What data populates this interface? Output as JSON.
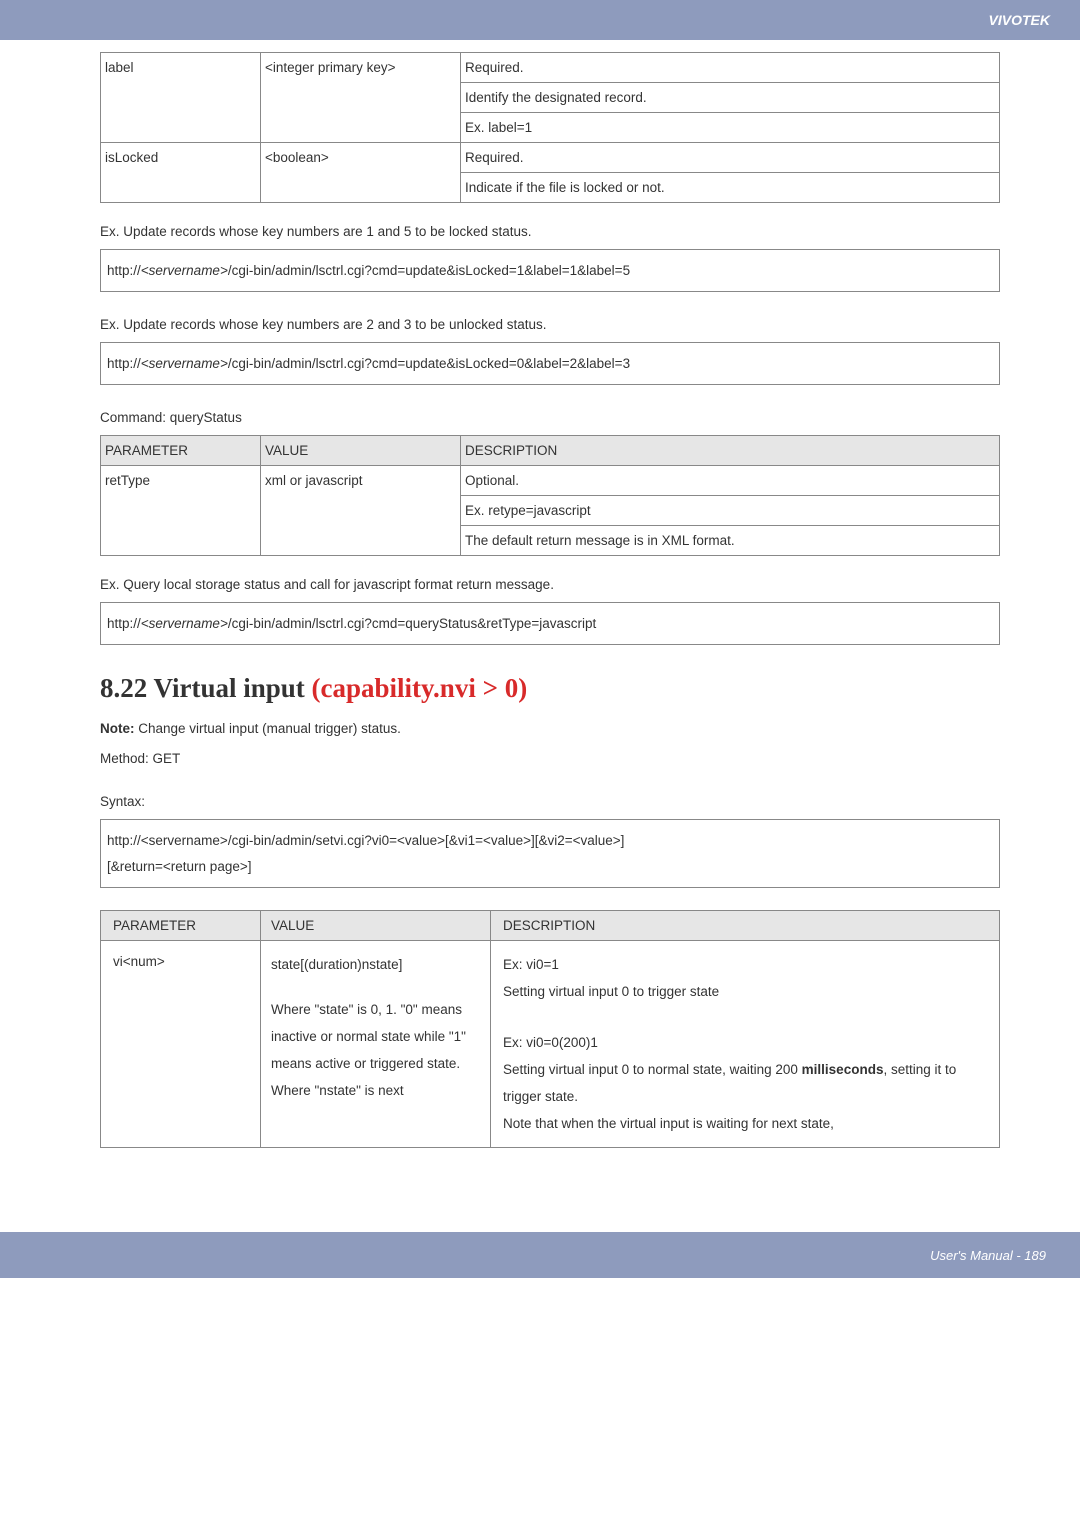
{
  "topbar": {
    "brand": "VIVOTEK"
  },
  "table1": {
    "rows": [
      {
        "param": "label",
        "value": "<integer primary key>",
        "desc_lines": [
          "Required.",
          "Identify the designated record.",
          "Ex. label=1"
        ]
      },
      {
        "param": "isLocked",
        "value": "<boolean>",
        "desc_lines": [
          "Required.",
          "Indicate if the file is locked or not."
        ]
      }
    ]
  },
  "ex1": {
    "caption": "Ex. Update records whose key numbers are 1 and 5 to be locked status.",
    "url_pre": "http://",
    "url_server": "<servername>",
    "url_post": "/cgi-bin/admin/lsctrl.cgi?cmd=update&isLocked=1&label=1&label=5"
  },
  "ex2": {
    "caption": "Ex. Update records whose key numbers are 2 and 3 to be unlocked status.",
    "url_pre": "http://",
    "url_server": "<servername>",
    "url_post": "/cgi-bin/admin/lsctrl.cgi?cmd=update&isLocked=0&label=2&label=3"
  },
  "qs": {
    "heading": "Command: queryStatus"
  },
  "table2": {
    "headers": {
      "p": "PARAMETER",
      "v": "VALUE",
      "d": "DESCRIPTION"
    },
    "rows": [
      {
        "param": "retType",
        "value": "xml or javascript",
        "desc_lines": [
          "Optional.",
          "Ex. retype=javascript",
          "The default return message is in XML format."
        ]
      }
    ]
  },
  "ex3": {
    "caption": "Ex. Query local storage status and call for javascript format return message.",
    "url_pre": "http://",
    "url_server": "<servername>",
    "url_post": "/cgi-bin/admin/lsctrl.cgi?cmd=queryStatus&retType=javascript"
  },
  "section": {
    "num_title": "8.22 Virtual input ",
    "red": "(capability.nvi > 0)",
    "note_label": "Note:",
    "note_text": " Change virtual input (manual trigger) status.",
    "method": "Method: GET",
    "syntax_label": "Syntax:",
    "syntax_line1": "http://<servername>/cgi-bin/admin/setvi.cgi?vi0=<value>[&vi1=<value>][&vi2=<value>]",
    "syntax_line2": "[&return=<return page>]"
  },
  "table3": {
    "headers": {
      "p": "PARAMETER",
      "v": "VALUE",
      "d": "DESCRIPTION"
    },
    "row": {
      "param": "vi<num>",
      "value_block1_line1": "state[(duration)nstate]",
      "value_block1_line2": "Where \"state\" is 0, 1. \"0\" means inactive or normal state while \"1\" means active or triggered state. Where \"nstate\" is next",
      "desc_block1_line1": "Ex: vi0=1",
      "desc_block1_line2": "Setting virtual input 0 to trigger state",
      "desc_block2_line1": "Ex: vi0=0(200)1",
      "desc_block2_line2_a": "Setting virtual input 0 to normal state, waiting 200 ",
      "desc_block2_line2_b": "milliseconds",
      "desc_block2_line2_c": ", setting it to trigger state.",
      "desc_block2_line3": "Note that when the virtual input is waiting for next state,"
    }
  },
  "footer": {
    "text": "User's Manual - 189"
  }
}
